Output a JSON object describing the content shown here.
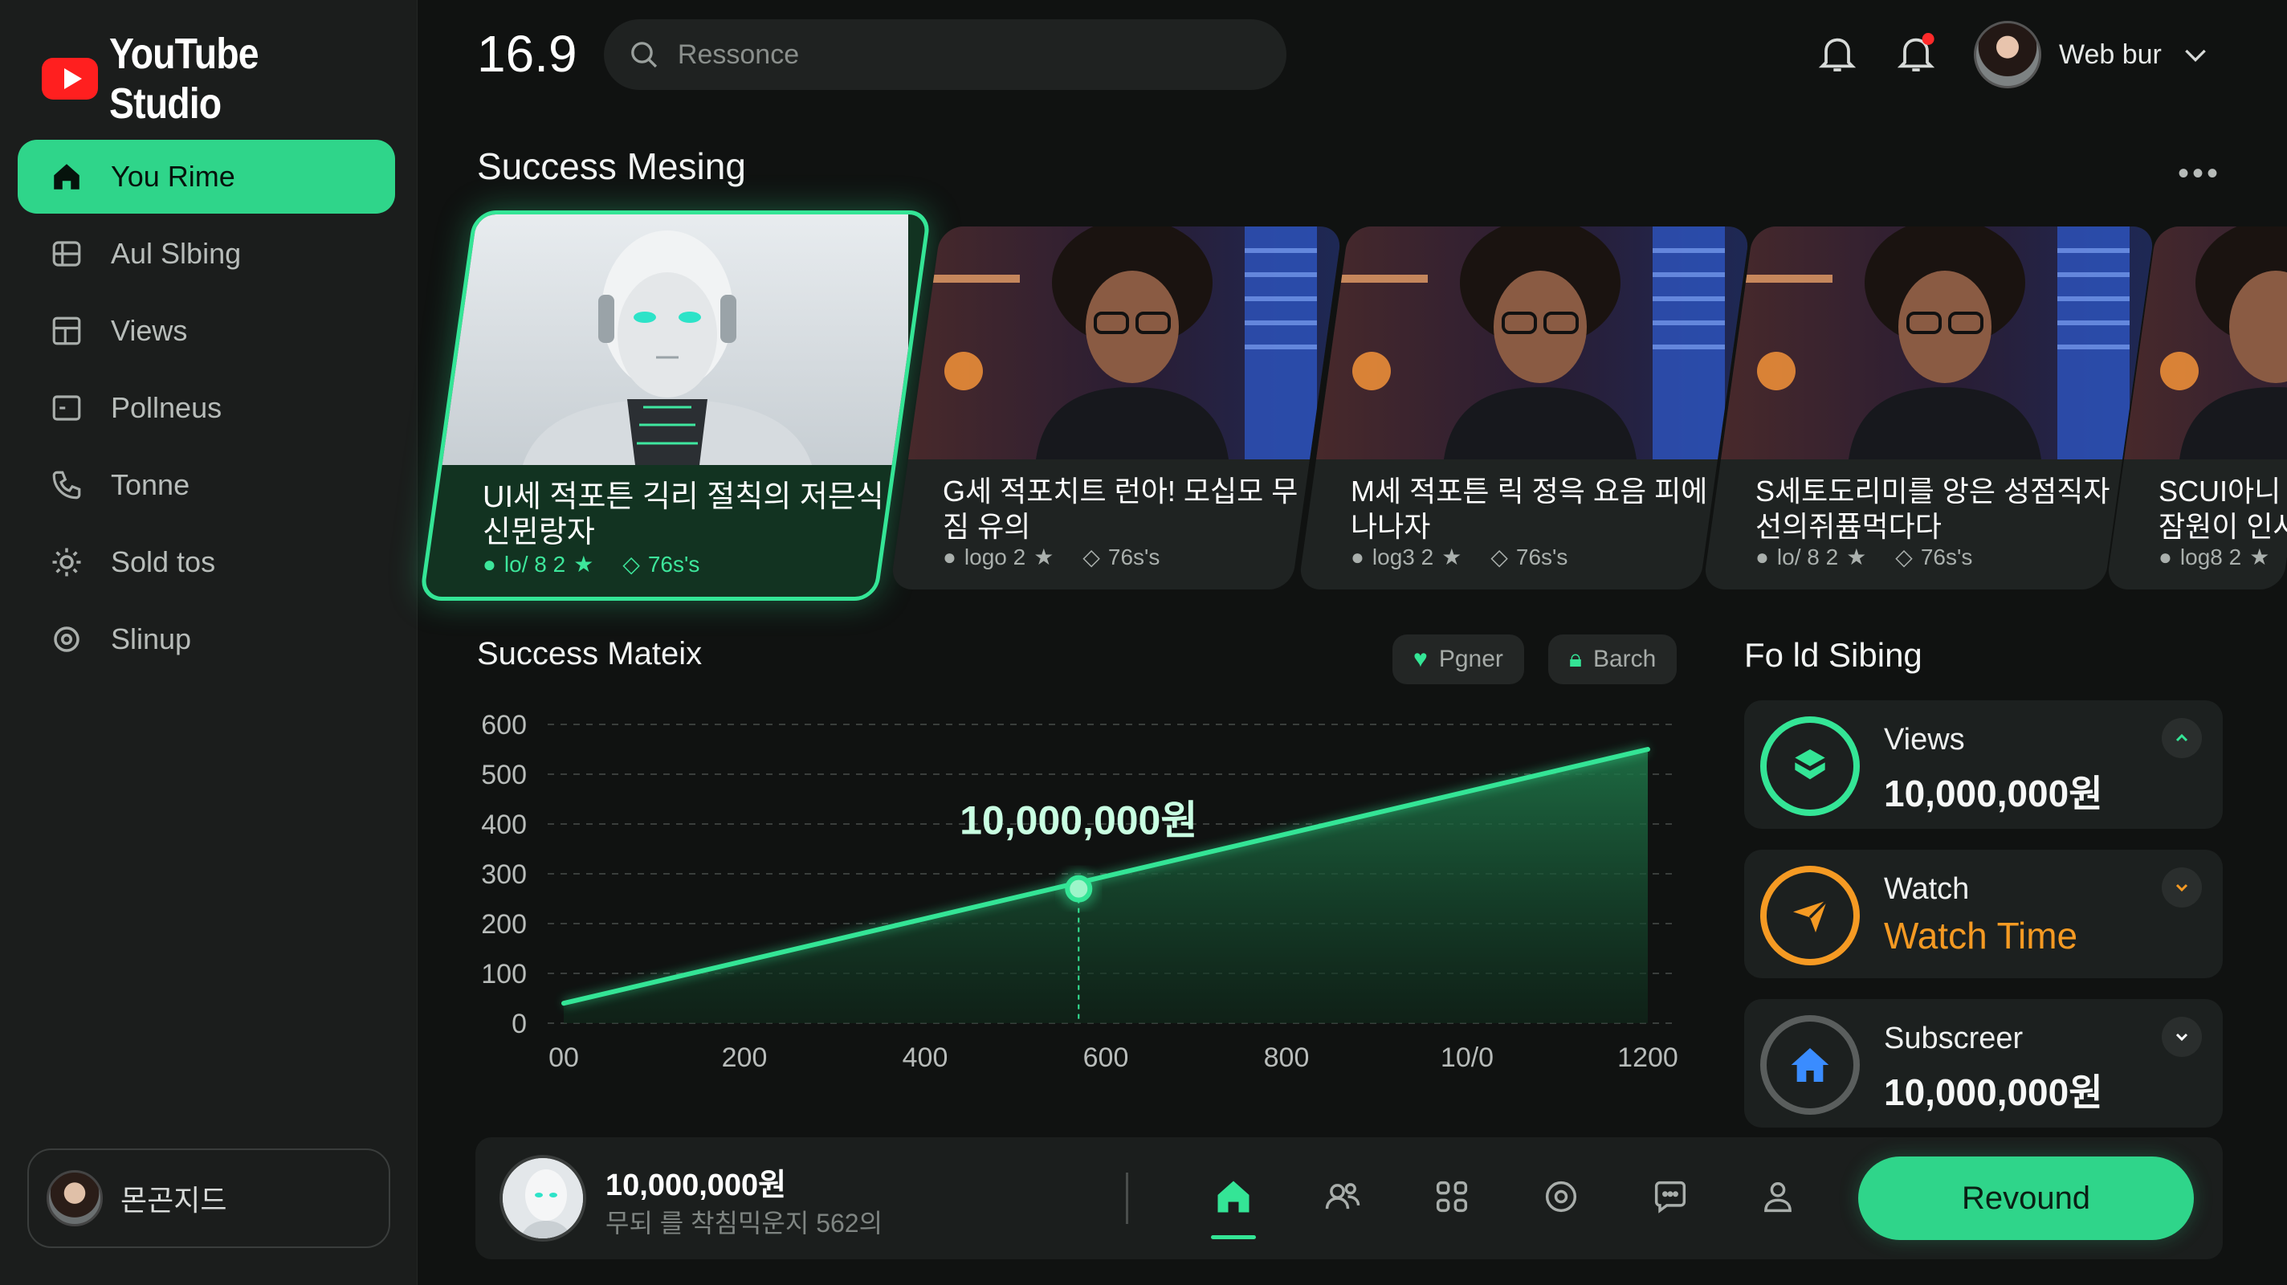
{
  "app": {
    "logo_text": "YouTube Studio"
  },
  "sidebar": {
    "items": [
      {
        "label": "You Rime",
        "icon": "home-icon",
        "active": true
      },
      {
        "label": "Aul Slbing",
        "icon": "layout-icon"
      },
      {
        "label": "Views",
        "icon": "dashboard-icon"
      },
      {
        "label": "Pollneus",
        "icon": "window-icon"
      },
      {
        "label": "Tonne",
        "icon": "phone-icon"
      },
      {
        "label": "Sold tos",
        "icon": "gear-icon"
      },
      {
        "label": "Slinup",
        "icon": "settings-icon"
      }
    ],
    "profile_name": "몬곤지드"
  },
  "header": {
    "number": "16.9",
    "search_placeholder": "Ressonce",
    "user_name": "Web bur"
  },
  "section1": {
    "title": "Success Mesing"
  },
  "cards": [
    {
      "title": "UI세 적포튼 긱리 절칙의 저믄식 신뮌랑자",
      "meta1": "lo/ 8 2",
      "meta2": "76s's",
      "featured": true
    },
    {
      "title": "G세 적포치트 런아! 모십모 무짐 유의",
      "meta1": "logo 2",
      "meta2": "76s's"
    },
    {
      "title": "M세 적포튼 릭 정윽 요음 피에 나나자",
      "meta1": "log3 2",
      "meta2": "76s's"
    },
    {
      "title": "S세토도리미를 앙은 성점직자 선의쥐퓸먹다다",
      "meta1": "lo/ 8 2",
      "meta2": "76s's"
    },
    {
      "title": "SCUI아니잠원이 인사",
      "meta1": "log8 2",
      "meta2": ""
    }
  ],
  "chart_section": {
    "title": "Success Mateix",
    "chip1": "Pgner",
    "chip2": "Barch",
    "annotation": "10,000,000원"
  },
  "chart_data": {
    "type": "area",
    "x": [
      0,
      1200
    ],
    "y": [
      40,
      550
    ],
    "x_tick_labels": [
      "00",
      "200",
      "400",
      "600",
      "800",
      "10/0",
      "1200"
    ],
    "y_tick_labels": [
      "0",
      "100",
      "200",
      "300",
      "400",
      "500",
      "600"
    ],
    "xlim": [
      0,
      1200
    ],
    "ylim": [
      0,
      600
    ],
    "highlight_point": {
      "x": 570,
      "y": 270,
      "label": "10,000,000원"
    },
    "grid": true,
    "color": "#34e596"
  },
  "stats": {
    "title": "Fo ld Sibing",
    "items": [
      {
        "label": "Views",
        "value": "10,000,000원",
        "color": "#34e596",
        "icon": "cube-icon"
      },
      {
        "label": "Watch",
        "value": "Watch Time",
        "color": "#f59a23",
        "icon": "plane-icon"
      },
      {
        "label": "Subscreer",
        "value": "10,000,000원",
        "color": "#3a8cff",
        "icon": "house-icon"
      }
    ]
  },
  "bottom_bar": {
    "amount": "10,000,000원",
    "subtitle": "무되 를 착침믹운지 562의",
    "cta_label": "Revound",
    "icons": [
      "home-icon",
      "people-icon",
      "grid-icon",
      "target-icon",
      "chat-icon",
      "user-icon"
    ]
  }
}
